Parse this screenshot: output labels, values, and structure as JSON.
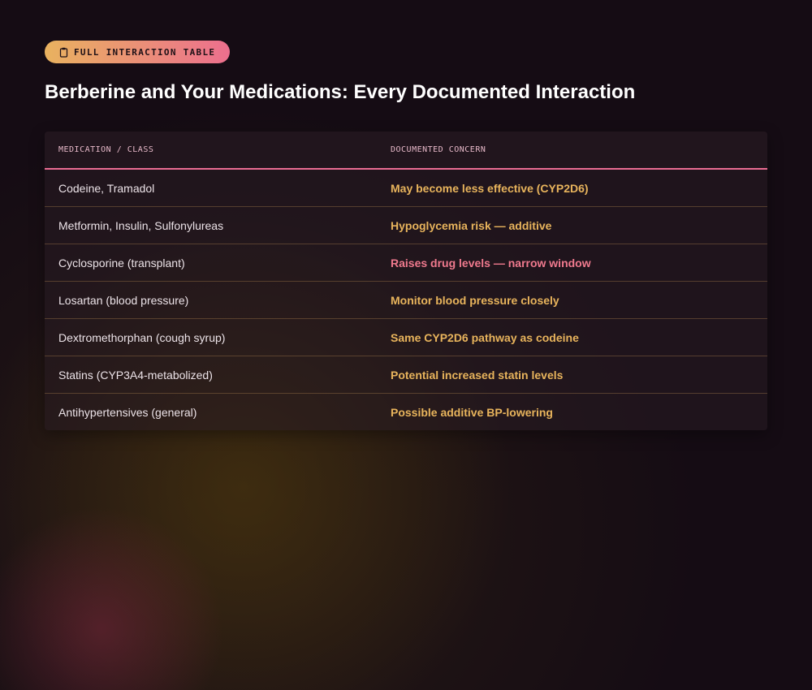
{
  "badge": {
    "icon": "clipboard-icon",
    "label": "FULL INTERACTION TABLE"
  },
  "page_title": "Berberine and Your Medications: Every Documented Interaction",
  "table": {
    "headers": [
      "MEDICATION / CLASS",
      "DOCUMENTED CONCERN"
    ],
    "rows": [
      {
        "medication": "Codeine, Tramadol",
        "concern": "May become less effective (CYP2D6)",
        "severity": "caution"
      },
      {
        "medication": "Metformin, Insulin, Sulfonylureas",
        "concern": "Hypoglycemia risk — additive",
        "severity": "caution"
      },
      {
        "medication": "Cyclosporine (transplant)",
        "concern": "Raises drug levels — narrow window",
        "severity": "danger"
      },
      {
        "medication": "Losartan (blood pressure)",
        "concern": "Monitor blood pressure closely",
        "severity": "caution"
      },
      {
        "medication": "Dextromethorphan (cough syrup)",
        "concern": "Same CYP2D6 pathway as codeine",
        "severity": "caution"
      },
      {
        "medication": "Statins (CYP3A4-metabolized)",
        "concern": "Potential increased statin levels",
        "severity": "caution"
      },
      {
        "medication": "Antihypertensives (general)",
        "concern": "Possible additive BP-lowering",
        "severity": "caution"
      }
    ]
  },
  "colors": {
    "caution": "#e8b45c",
    "danger": "#f07a8e",
    "accent_pink": "#ea6c93",
    "badge_gradient_start": "#e9b25f",
    "badge_gradient_end": "#ec6f8e"
  }
}
